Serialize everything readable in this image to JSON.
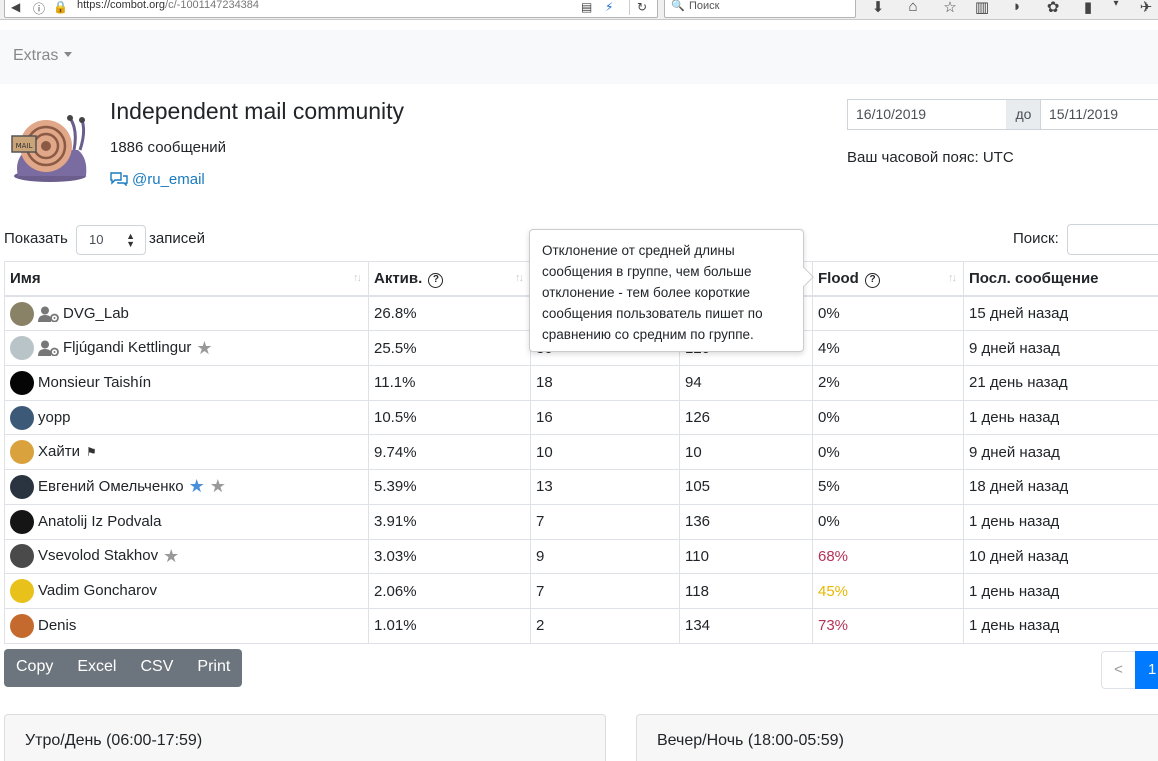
{
  "browser": {
    "url_main": "https://combot.org",
    "url_path": "/c/-1001147234384",
    "search_placeholder": "Поиск"
  },
  "navbar": {
    "extras_label": "Extras"
  },
  "group": {
    "title": "Independent mail community",
    "messages": "1886 сообщений",
    "username": "@ru_email"
  },
  "date_range": {
    "from": "16/10/2019",
    "sep": "до",
    "to": "15/11/2019"
  },
  "timezone": "Ваш часовой пояс: UTC",
  "controls": {
    "show_label": "Показать",
    "page_size": "10",
    "entries_label": "записей",
    "search_label": "Поиск:"
  },
  "table": {
    "columns": [
      "Имя",
      "Актив.",
      "",
      "",
      "Flood",
      "Посл. сообщение"
    ],
    "rows": [
      {
        "name": "DVG_Lab",
        "activity": "26.8%",
        "col3": "",
        "col4": "",
        "flood": "0%",
        "last": "15 дней назад",
        "admin": true,
        "stars": [],
        "flag": false,
        "flood_color": "",
        "avatar_color": "#8a8266"
      },
      {
        "name": "Fljúgandi Kettlingur",
        "activity": "25.5%",
        "col3": "",
        "col4": "",
        "flood": "4%",
        "last": "9 дней назад",
        "admin": true,
        "stars": [
          "gray"
        ],
        "flag": false,
        "flood_color": "",
        "avatar_color": "#b8c4c8"
      },
      {
        "name": "Monsieur Taishín",
        "activity": "11.1%",
        "col3": "18",
        "col4": "94",
        "flood": "2%",
        "last": "21 день назад",
        "admin": false,
        "stars": [],
        "flag": false,
        "flood_color": "",
        "avatar_color": "#050505"
      },
      {
        "name": "yopp",
        "activity": "10.5%",
        "col3": "16",
        "col4": "126",
        "flood": "0%",
        "last": "1 день назад",
        "admin": false,
        "stars": [],
        "flag": false,
        "flood_color": "",
        "avatar_color": "#3c5a78"
      },
      {
        "name": "Хайти",
        "activity": "9.74%",
        "col3": "10",
        "col4": "10",
        "flood": "0%",
        "last": "9 дней назад",
        "admin": false,
        "stars": [],
        "flag": true,
        "flood_color": "",
        "avatar_color": "#d9a23c"
      },
      {
        "name": "Евгений Омельченко",
        "activity": "5.39%",
        "col3": "13",
        "col4": "105",
        "flood": "5%",
        "last": "18 дней назад",
        "admin": false,
        "stars": [
          "blue",
          "gray"
        ],
        "flag": false,
        "flood_color": "",
        "avatar_color": "#2a3440"
      },
      {
        "name": "Anatolij Iz Podvala",
        "activity": "3.91%",
        "col3": "7",
        "col4": "136",
        "flood": "0%",
        "last": "1 день назад",
        "admin": false,
        "stars": [],
        "flag": false,
        "flood_color": "",
        "avatar_color": "#151515"
      },
      {
        "name": "Vsevolod Stakhov",
        "activity": "3.03%",
        "col3": "9",
        "col4": "110",
        "flood": "68%",
        "last": "10 дней назад",
        "admin": false,
        "stars": [
          "gray"
        ],
        "flag": false,
        "flood_color": "#b43257",
        "avatar_color": "#4a4a4a"
      },
      {
        "name": "Vadim Goncharov",
        "activity": "2.06%",
        "col3": "7",
        "col4": "118",
        "flood": "45%",
        "last": "1 день назад",
        "admin": false,
        "stars": [],
        "flag": false,
        "flood_color": "#e6b800",
        "avatar_color": "#e8c21a"
      },
      {
        "name": "Denis",
        "activity": "1.01%",
        "col3": "2",
        "col4": "134",
        "flood": "73%",
        "last": "1 день назад",
        "admin": false,
        "stars": [],
        "flag": false,
        "flood_color": "#b43257",
        "avatar_color": "#c46a2e"
      }
    ],
    "hidden_row_fragments": {
      "row2_col3": "30",
      "row2_col4": "120"
    }
  },
  "tooltip": {
    "text": "Отклонение от средней длины сообщения в группе, чем больше отклонение - тем более короткие сообщения пользователь пишет по сравнению со средним по группе."
  },
  "export_buttons": [
    "Copy",
    "Excel",
    "CSV",
    "Print"
  ],
  "pagination": {
    "prev": "<",
    "current": "1"
  },
  "cards": {
    "day": "Утро/День (06:00-17:59)",
    "night": "Вечер/Ночь (18:00-05:59)"
  },
  "colors": {
    "link": "#1a7bbf",
    "btn_gray": "#6c757d",
    "primary": "#007bff"
  }
}
